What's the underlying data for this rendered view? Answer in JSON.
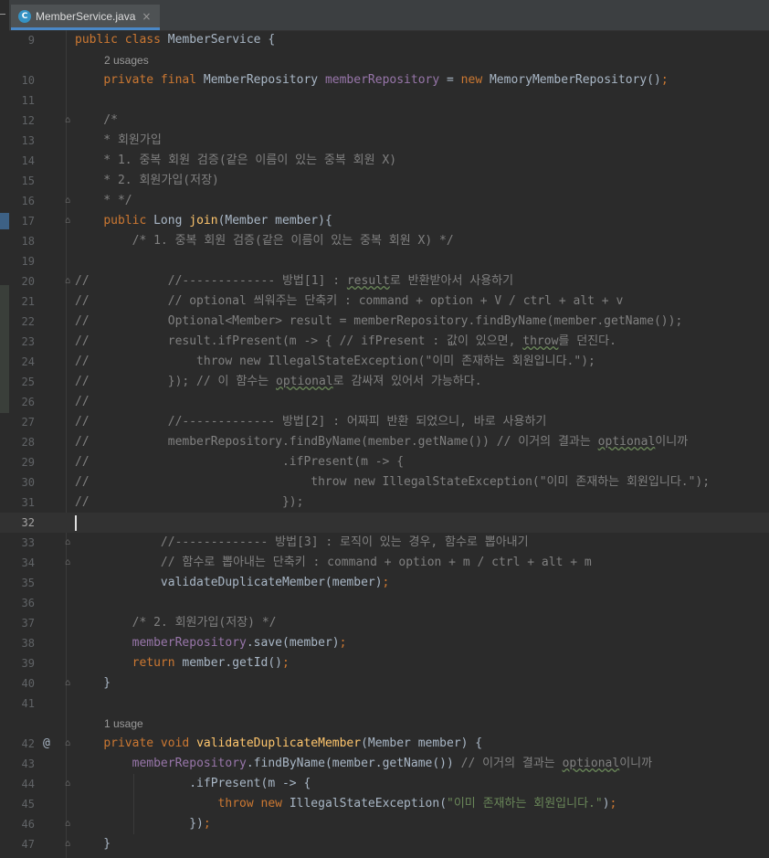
{
  "tab": {
    "icon_letter": "C",
    "title": "MemberService.java",
    "close": "×"
  },
  "lines": [
    {
      "n": "9",
      "t": [
        [
          "k",
          "public class "
        ],
        [
          "y",
          "MemberService {"
        ]
      ]
    },
    {
      "hint": "2 usages"
    },
    {
      "n": "10",
      "t": [
        [
          "y",
          "    "
        ],
        [
          "k",
          "private final "
        ],
        [
          "y",
          "MemberRepository "
        ],
        [
          "f",
          "memberRepository"
        ],
        [
          "y",
          " = "
        ],
        [
          "k",
          "new "
        ],
        [
          "y",
          "MemoryMemberRepository()"
        ],
        [
          "k",
          ";"
        ]
      ]
    },
    {
      "n": "11",
      "t": []
    },
    {
      "n": "12",
      "fold": true,
      "t": [
        [
          "c",
          "    /*"
        ]
      ]
    },
    {
      "n": "13",
      "t": [
        [
          "c",
          "    * 회원가입"
        ]
      ]
    },
    {
      "n": "14",
      "t": [
        [
          "c",
          "    * 1. 중복 회원 검증(같은 이름이 있는 중복 회원 X)"
        ]
      ]
    },
    {
      "n": "15",
      "t": [
        [
          "c",
          "    * 2. 회원가입(저장)"
        ]
      ]
    },
    {
      "n": "16",
      "fold": true,
      "t": [
        [
          "c",
          "    * */"
        ]
      ]
    },
    {
      "n": "17",
      "fold": true,
      "t": [
        [
          "y",
          "    "
        ],
        [
          "k",
          "public "
        ],
        [
          "y",
          "Long "
        ],
        [
          "m",
          "join"
        ],
        [
          "y",
          "(Member member){"
        ]
      ]
    },
    {
      "n": "18",
      "t": [
        [
          "c",
          "        /* 1. 중복 회원 검증(같은 이름이 있는 중복 회원 X) */"
        ]
      ]
    },
    {
      "n": "19",
      "t": []
    },
    {
      "n": "20",
      "fold": true,
      "t": [
        [
          "c",
          "//           //------------- 방법[1] : "
        ],
        [
          "cw",
          "result"
        ],
        [
          "c",
          "로 반환받아서 사용하기"
        ]
      ]
    },
    {
      "n": "21",
      "t": [
        [
          "c",
          "//           // optional 씌워주는 단축키 : command + option + V / ctrl + alt + v"
        ]
      ]
    },
    {
      "n": "22",
      "t": [
        [
          "c",
          "//           Optional<Member> result = memberRepository.findByName(member.getName());"
        ]
      ]
    },
    {
      "n": "23",
      "t": [
        [
          "c",
          "//           result.ifPresent(m -> { // ifPresent : 값이 있으면, "
        ],
        [
          "cw",
          "throw"
        ],
        [
          "c",
          "를 던진다."
        ]
      ]
    },
    {
      "n": "24",
      "t": [
        [
          "c",
          "//               throw new IllegalStateException(\"이미 존재하는 회원입니다.\");"
        ]
      ]
    },
    {
      "n": "25",
      "t": [
        [
          "c",
          "//           }); // 이 함수는 "
        ],
        [
          "cw",
          "optional"
        ],
        [
          "c",
          "로 감싸져 있어서 가능하다."
        ]
      ]
    },
    {
      "n": "26",
      "t": [
        [
          "c",
          "//"
        ]
      ]
    },
    {
      "n": "27",
      "t": [
        [
          "c",
          "//           //------------- 방법[2] : 어짜피 반환 되었으니, 바로 사용하기"
        ]
      ]
    },
    {
      "n": "28",
      "t": [
        [
          "c",
          "//           memberRepository.findByName(member.getName()) // 이거의 결과는 "
        ],
        [
          "cw",
          "optional"
        ],
        [
          "c",
          "이니까"
        ]
      ]
    },
    {
      "n": "29",
      "t": [
        [
          "c",
          "//                           .ifPresent(m -> {"
        ]
      ]
    },
    {
      "n": "30",
      "t": [
        [
          "c",
          "//                               throw new IllegalStateException(\"이미 존재하는 회원입니다.\");"
        ]
      ]
    },
    {
      "n": "31",
      "t": [
        [
          "c",
          "//                           });"
        ]
      ]
    },
    {
      "n": "32",
      "cur": true,
      "t": []
    },
    {
      "n": "33",
      "fold": true,
      "t": [
        [
          "c",
          "            //------------- 방법[3] : 로직이 있는 경우, 함수로 뽑아내기"
        ]
      ]
    },
    {
      "n": "34",
      "fold": true,
      "t": [
        [
          "c",
          "            // 함수로 뽑아내는 단축키 : command + option + m / ctrl + alt + m"
        ]
      ]
    },
    {
      "n": "35",
      "t": [
        [
          "y",
          "            validateDuplicateMember(member)"
        ],
        [
          "k",
          ";"
        ]
      ]
    },
    {
      "n": "36",
      "t": []
    },
    {
      "n": "37",
      "t": [
        [
          "c",
          "        /* 2. 회원가입(저장) */"
        ]
      ]
    },
    {
      "n": "38",
      "t": [
        [
          "y",
          "        "
        ],
        [
          "f",
          "memberRepository"
        ],
        [
          "y",
          ".save(member)"
        ],
        [
          "k",
          ";"
        ]
      ]
    },
    {
      "n": "39",
      "t": [
        [
          "y",
          "        "
        ],
        [
          "k",
          "return "
        ],
        [
          "y",
          "member.getId()"
        ],
        [
          "k",
          ";"
        ]
      ]
    },
    {
      "n": "40",
      "fold": true,
      "t": [
        [
          "y",
          "    }"
        ]
      ]
    },
    {
      "n": "41",
      "t": []
    },
    {
      "hint": "1 usage"
    },
    {
      "n": "42",
      "at": "@",
      "fold": true,
      "t": [
        [
          "y",
          "    "
        ],
        [
          "k",
          "private void "
        ],
        [
          "m",
          "validateDuplicateMember"
        ],
        [
          "y",
          "(Member member) {"
        ]
      ]
    },
    {
      "n": "43",
      "t": [
        [
          "y",
          "        "
        ],
        [
          "f",
          "memberRepository"
        ],
        [
          "y",
          ".findByName(member.getName()) "
        ],
        [
          "c",
          "// 이거의 결과는 "
        ],
        [
          "cw",
          "optional"
        ],
        [
          "c",
          "이니까"
        ]
      ]
    },
    {
      "n": "44",
      "fold": true,
      "t": [
        [
          "y",
          "                .ifPresent(m -> {"
        ]
      ]
    },
    {
      "n": "45",
      "t": [
        [
          "y",
          "                    "
        ],
        [
          "k",
          "throw new "
        ],
        [
          "y",
          "IllegalStateException("
        ],
        [
          "s",
          "\"이미 존재하는 회원입니다.\""
        ],
        [
          "y",
          ")"
        ],
        [
          "k",
          ";"
        ]
      ]
    },
    {
      "n": "46",
      "fold": true,
      "t": [
        [
          "y",
          "                })"
        ],
        [
          "k",
          ";"
        ]
      ]
    },
    {
      "n": "47",
      "fold": true,
      "t": [
        [
          "y",
          "    }"
        ]
      ]
    }
  ]
}
